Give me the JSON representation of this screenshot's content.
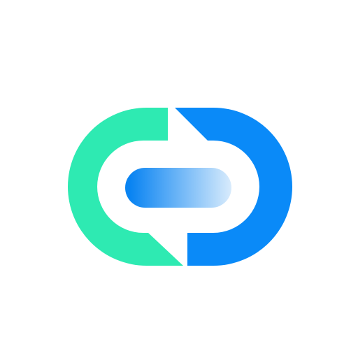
{
  "logo": {
    "name": "app-logo",
    "icon": "link-chain-icon",
    "colors": {
      "background": "#ffffff",
      "left_arc": "#2EEAB2",
      "right_arc": "#0A8AF8",
      "bar_gradient_start": "#0A84F2",
      "bar_gradient_end": "#D8EBFC"
    }
  }
}
